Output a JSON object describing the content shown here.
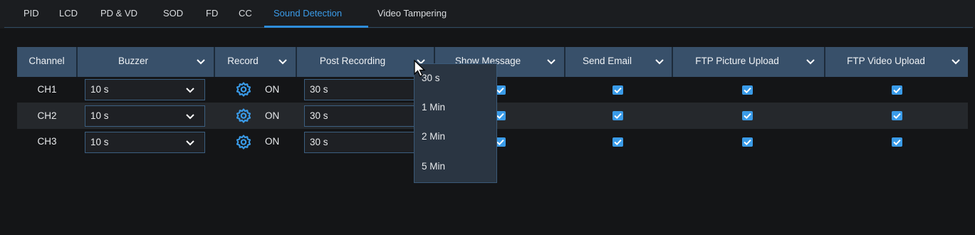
{
  "tabs": [
    {
      "label": "PID"
    },
    {
      "label": "LCD"
    },
    {
      "label": "PD & VD"
    },
    {
      "label": "SOD"
    },
    {
      "label": "FD"
    },
    {
      "label": "CC"
    },
    {
      "label": "Sound Detection"
    },
    {
      "label": "Video Tampering"
    }
  ],
  "active_tab": "Sound Detection",
  "columns": {
    "channel": "Channel",
    "buzzer": "Buzzer",
    "record": "Record",
    "post_recording": "Post Recording",
    "show_message": "Show Message",
    "send_email": "Send Email",
    "ftp_picture": "FTP Picture Upload",
    "ftp_video": "FTP Video Upload"
  },
  "rows": [
    {
      "channel": "CH1",
      "buzzer": "10 s",
      "record": "ON",
      "post_recording": "30 s",
      "show_message": true,
      "send_email": true,
      "ftp_picture": true,
      "ftp_video": true
    },
    {
      "channel": "CH2",
      "buzzer": "10 s",
      "record": "ON",
      "post_recording": "30 s",
      "show_message": true,
      "send_email": true,
      "ftp_picture": true,
      "ftp_video": true
    },
    {
      "channel": "CH3",
      "buzzer": "10 s",
      "record": "ON",
      "post_recording": "30 s",
      "show_message": true,
      "send_email": true,
      "ftp_picture": true,
      "ftp_video": true
    }
  ],
  "post_recording_menu": {
    "options": [
      "30 s",
      "1 Min",
      "2 Min",
      "5 Min"
    ]
  },
  "colors": {
    "accent": "#3a9be8",
    "header_bg": "#38506a",
    "background": "#141517",
    "dropdown_bg": "#2a3542"
  }
}
